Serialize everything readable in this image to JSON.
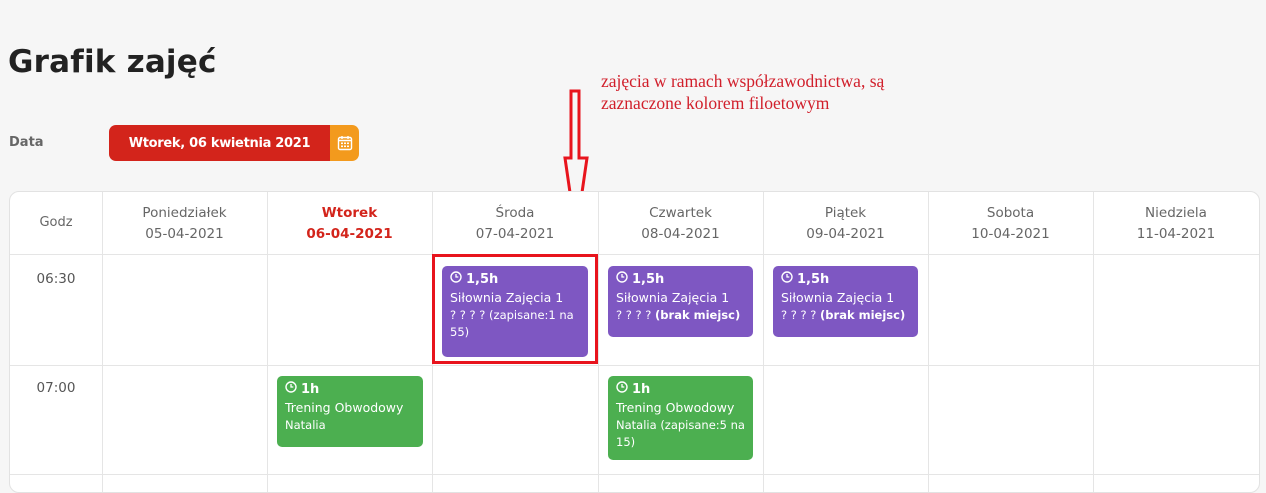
{
  "page": {
    "title": "Grafik zajęć"
  },
  "date": {
    "label": "Data",
    "value": "Wtorek, 06 kwietnia 2021"
  },
  "annotation": {
    "text": "zajęcia w ramach współzawodnictwa, są zaznaczone kolorem filoetowym"
  },
  "schedule": {
    "hour_header": "Godz",
    "days": [
      {
        "name": "Poniedziałek",
        "date": "05-04-2021"
      },
      {
        "name": "Wtorek",
        "date": "06-04-2021"
      },
      {
        "name": "Środa",
        "date": "07-04-2021"
      },
      {
        "name": "Czwartek",
        "date": "08-04-2021"
      },
      {
        "name": "Piątek",
        "date": "09-04-2021"
      },
      {
        "name": "Sobota",
        "date": "10-04-2021"
      },
      {
        "name": "Niedziela",
        "date": "11-04-2021"
      }
    ],
    "times": [
      "06:30",
      "07:00"
    ],
    "events": [
      {
        "duration": "1,5h",
        "name": "Siłownia Zajęcia 1",
        "trainer": "? ? ? ?",
        "status": "(zapisane:1 na 55)",
        "color": "#7e57c2"
      },
      {
        "duration": "1,5h",
        "name": "Siłownia Zajęcia 1",
        "trainer": "? ? ? ?",
        "status": "(brak miejsc)",
        "color": "#7e57c2"
      },
      {
        "duration": "1,5h",
        "name": "Siłownia Zajęcia 1",
        "trainer": "? ? ? ?",
        "status": "(brak miejsc)",
        "color": "#7e57c2"
      },
      {
        "duration": "1h",
        "name": "Trening Obwodowy",
        "trainer": "Natalia",
        "status": "",
        "color": "#4caf50"
      },
      {
        "duration": "1h",
        "name": "Trening Obwodowy",
        "trainer": "Natalia",
        "status": "(zapisane:5 na 15)",
        "color": "#4caf50"
      }
    ]
  },
  "colors": {
    "accent_red": "#d3241b",
    "calendar_orange": "#f39a1d",
    "annotation_red": "#d11f2b"
  }
}
